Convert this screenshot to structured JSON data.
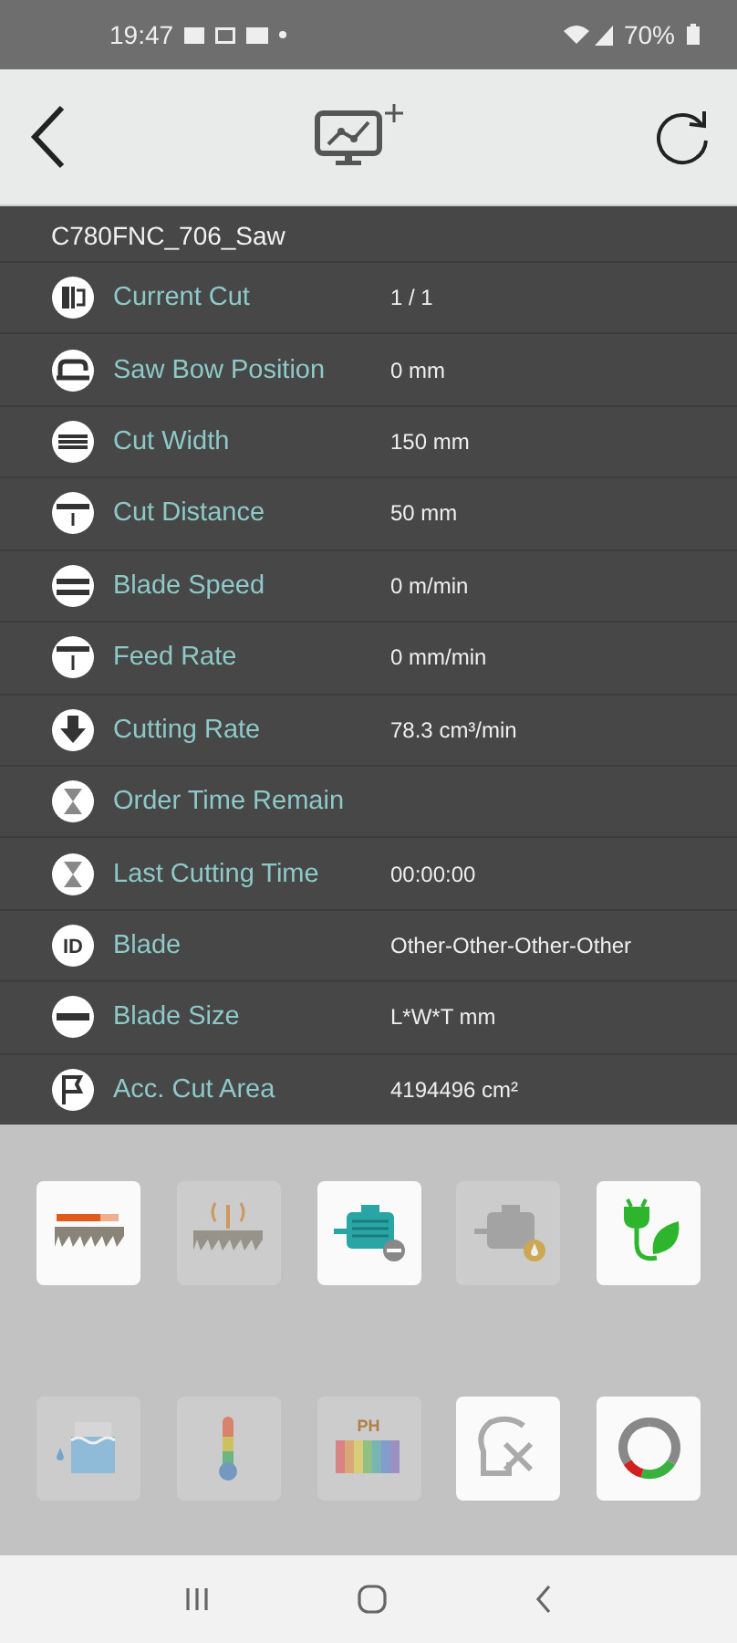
{
  "status_bar": {
    "time": "19:47",
    "battery": "70%"
  },
  "machine": {
    "name": "C780FNC_706_Saw"
  },
  "rows": [
    {
      "kind": "cut",
      "label": "Current Cut",
      "value": "1 / 1"
    },
    {
      "kind": "bow",
      "label": "Saw Bow Position",
      "value": "0 mm"
    },
    {
      "kind": "width",
      "label": "Cut Width",
      "value": "150 mm"
    },
    {
      "kind": "distance",
      "label": "Cut Distance",
      "value": "50 mm"
    },
    {
      "kind": "speed",
      "label": "Blade Speed",
      "value": "0 m/min"
    },
    {
      "kind": "feed",
      "label": "Feed Rate",
      "value": "0 mm/min"
    },
    {
      "kind": "rate",
      "label": "Cutting Rate",
      "value": "78.3 cm³/min"
    },
    {
      "kind": "hourglass",
      "label": "Order Time Remain"
    },
    {
      "kind": "hourglass",
      "label": "Last Cutting Time",
      "value": "00:00:00"
    },
    {
      "kind": "id",
      "icon_text": "ID",
      "label": "Blade",
      "value": "Other-Other-Other-Other"
    },
    {
      "kind": "size",
      "label": "Blade Size",
      "value": "L*W*T mm"
    },
    {
      "kind": "flag",
      "label": "Acc. Cut Area",
      "value": "4194496 cm²"
    }
  ],
  "tiles": [
    {
      "kind": "blade",
      "disabled": false
    },
    {
      "kind": "blade-signal",
      "disabled": true
    },
    {
      "kind": "motor",
      "disabled": false
    },
    {
      "kind": "motor-oil",
      "disabled": true
    },
    {
      "kind": "eco",
      "disabled": false
    },
    {
      "kind": "coolant",
      "disabled": true
    },
    {
      "kind": "thermometer",
      "disabled": true
    },
    {
      "kind": "ph",
      "icon_text": "PH",
      "disabled": true
    },
    {
      "kind": "head-tools",
      "disabled": false
    },
    {
      "kind": "ring",
      "disabled": false
    }
  ]
}
